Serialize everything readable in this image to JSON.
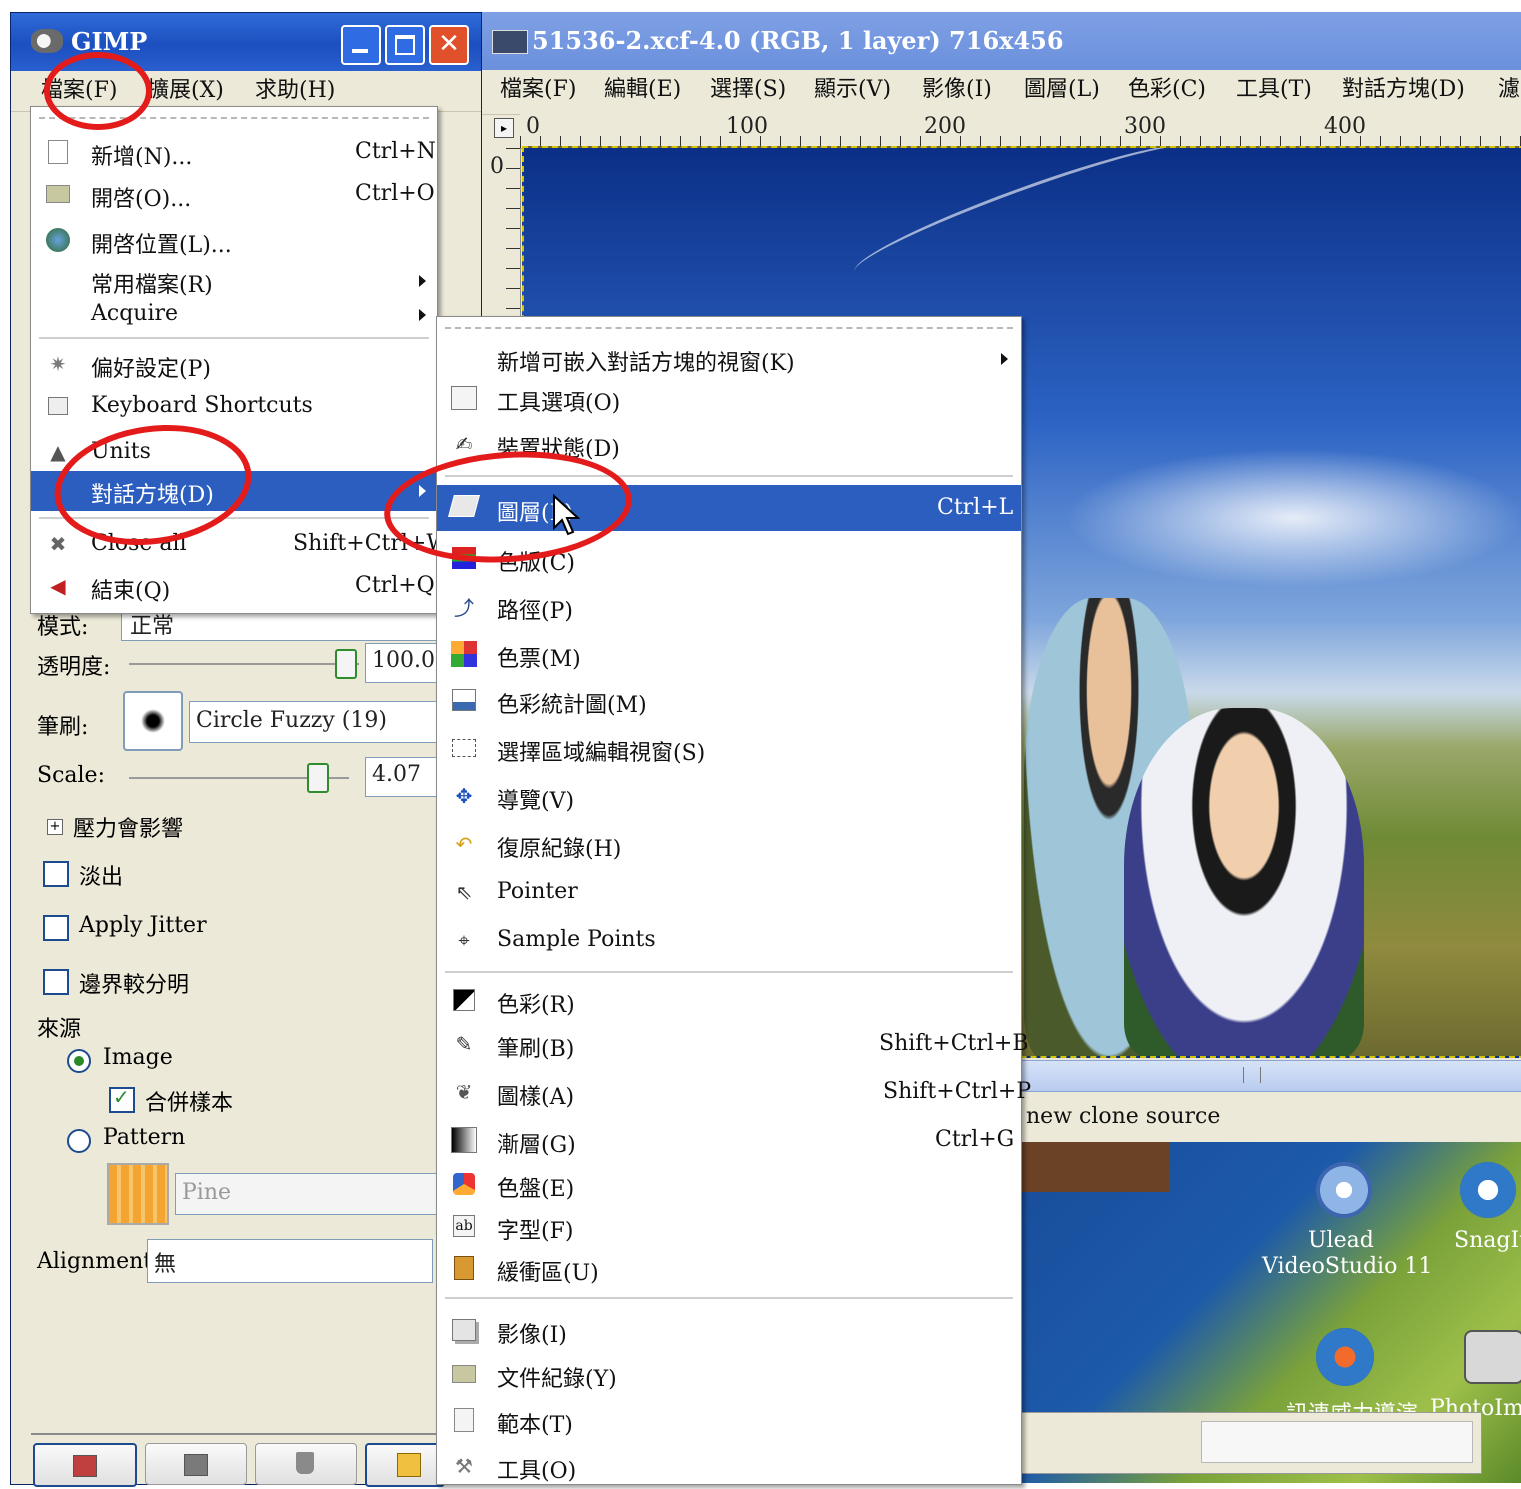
{
  "toolbox": {
    "title": "GIMP",
    "menu": [
      "檔案(F)",
      "擴展(X)",
      "求助(H)"
    ],
    "options": {
      "mode_label": "模式:",
      "mode_value": "正常",
      "opacity_label": "透明度:",
      "opacity_value": "100.0",
      "brush_label": "筆刷:",
      "brush_value": "Circle Fuzzy (19)",
      "scale_label": "Scale:",
      "scale_value": "4.07",
      "pressure_label": "壓力會影響",
      "fade_label": "淡出",
      "jitter_label": "Apply Jitter",
      "hard_edge_label": "邊界較分明",
      "source_label": "來源",
      "image_radio": "Image",
      "sample_merged": "合併樣本",
      "pattern_radio": "Pattern",
      "pattern_value": "Pine",
      "alignment_label": "Alignment:",
      "alignment_value": "無"
    }
  },
  "file_menu": {
    "items": [
      {
        "label": "新增(N)...",
        "shortcut": "Ctrl+N",
        "icon": "new-document-icon"
      },
      {
        "label": "開啓(O)...",
        "shortcut": "Ctrl+O",
        "icon": "open-folder-icon"
      },
      {
        "label": "開啓位置(L)...",
        "shortcut": "",
        "icon": "globe-icon"
      },
      {
        "label": "常用檔案(R)",
        "shortcut": "",
        "icon": ""
      },
      {
        "label": "Acquire",
        "shortcut": "",
        "icon": ""
      },
      {
        "label": "偏好設定(P)",
        "shortcut": "",
        "icon": "preferences-icon"
      },
      {
        "label": "Keyboard Shortcuts",
        "shortcut": "",
        "icon": "keyboard-icon"
      },
      {
        "label": "Units",
        "shortcut": "",
        "icon": "compass-icon"
      },
      {
        "label": "對話方塊(D)",
        "shortcut": "",
        "icon": ""
      },
      {
        "label": "Close all",
        "shortcut": "Shift+Ctrl+W",
        "icon": "close-all-icon"
      },
      {
        "label": "結束(Q)",
        "shortcut": "Ctrl+Q",
        "icon": "quit-icon"
      }
    ]
  },
  "image_window": {
    "title": "51536-2.xcf-4.0 (RGB, 1 layer) 716x456",
    "menu": [
      "檔案(F)",
      "編輯(E)",
      "選擇(S)",
      "顯示(V)",
      "影像(I)",
      "圖層(L)",
      "色彩(C)",
      "工具(T)",
      "對話方塊(D)",
      "濾"
    ],
    "ruler": [
      "0",
      "100",
      "200",
      "300",
      "400"
    ],
    "ruler_v": "0",
    "status": "new clone source"
  },
  "dialogs_menu": {
    "items": [
      {
        "label": "新增可嵌入對話方塊的視窗(K)",
        "shortcut": "",
        "icon": ""
      },
      {
        "label": "工具選項(O)",
        "shortcut": "",
        "icon": "tool-options-icon"
      },
      {
        "label": "裝置狀態(D)",
        "shortcut": "",
        "icon": "device-status-icon"
      },
      {
        "label": "圖層(L)",
        "shortcut": "Ctrl+L",
        "icon": "layers-icon"
      },
      {
        "label": "色版(C)",
        "shortcut": "",
        "icon": "channels-icon"
      },
      {
        "label": "路徑(P)",
        "shortcut": "",
        "icon": "paths-icon"
      },
      {
        "label": "色票(M)",
        "shortcut": "",
        "icon": "colormap-icon"
      },
      {
        "label": "色彩統計圖(M)",
        "shortcut": "",
        "icon": "histogram-icon"
      },
      {
        "label": "選擇區域編輯視窗(S)",
        "shortcut": "",
        "icon": "selection-editor-icon"
      },
      {
        "label": "導覽(V)",
        "shortcut": "",
        "icon": "navigation-icon"
      },
      {
        "label": "復原紀錄(H)",
        "shortcut": "",
        "icon": "undo-history-icon"
      },
      {
        "label": "Pointer",
        "shortcut": "",
        "icon": "pointer-icon"
      },
      {
        "label": "Sample Points",
        "shortcut": "",
        "icon": "sample-points-icon"
      },
      {
        "label": "色彩(R)",
        "shortcut": "",
        "icon": "colors-icon"
      },
      {
        "label": "筆刷(B)",
        "shortcut": "Shift+Ctrl+B",
        "icon": "brushes-icon"
      },
      {
        "label": "圖樣(A)",
        "shortcut": "Shift+Ctrl+P",
        "icon": "patterns-icon"
      },
      {
        "label": "漸層(G)",
        "shortcut": "Ctrl+G",
        "icon": "gradients-icon"
      },
      {
        "label": "色盤(E)",
        "shortcut": "",
        "icon": "palettes-icon"
      },
      {
        "label": "字型(F)",
        "shortcut": "",
        "icon": "fonts-icon"
      },
      {
        "label": "緩衝區(U)",
        "shortcut": "",
        "icon": "buffers-icon"
      },
      {
        "label": "影像(I)",
        "shortcut": "",
        "icon": "images-icon"
      },
      {
        "label": "文件紀錄(Y)",
        "shortcut": "",
        "icon": "document-history-icon"
      },
      {
        "label": "範本(T)",
        "shortcut": "",
        "icon": "templates-icon"
      },
      {
        "label": "工具(O)",
        "shortcut": "",
        "icon": "tools-icon"
      }
    ]
  },
  "desktop": {
    "icons": [
      {
        "label_line1": "Ulead",
        "label_line2": "VideoStudio 11"
      },
      {
        "label_line1": "SnagIt",
        "label_line2": ""
      },
      {
        "label_line1": "訊連威力導演",
        "label_line2": ""
      },
      {
        "label_line1": "PhotoImpa",
        "label_line2": ""
      }
    ]
  },
  "colors": {
    "selection": "#2c5ec0",
    "annotation_circle": "#e31b1b",
    "titlebar": "#1c4fbf"
  }
}
